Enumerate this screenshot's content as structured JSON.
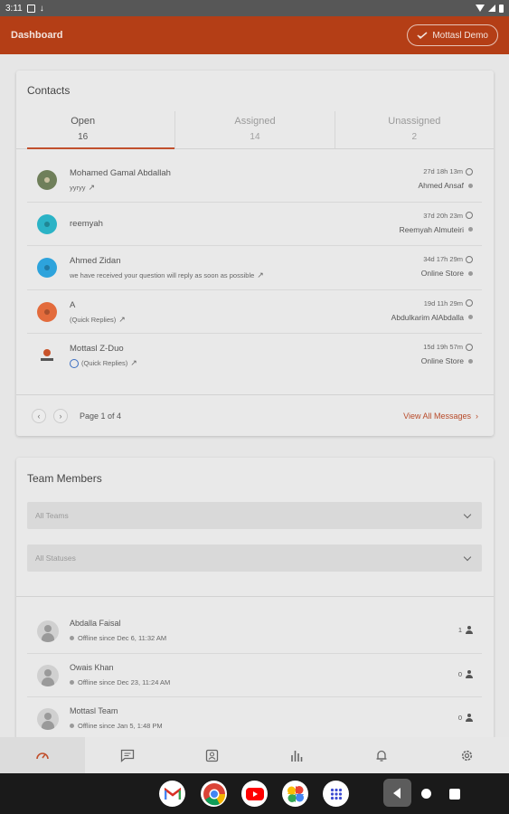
{
  "status_bar": {
    "time": "3:11"
  },
  "app_bar": {
    "title": "Dashboard",
    "user_button": "Mottasl Demo"
  },
  "contacts": {
    "title": "Contacts",
    "tabs": [
      {
        "label": "Open",
        "count": "16"
      },
      {
        "label": "Assigned",
        "count": "14"
      },
      {
        "label": "Unassigned",
        "count": "2"
      }
    ],
    "messages": [
      {
        "name": "Mohamed Gamal Abdallah",
        "preview": "yyryy",
        "time": "27d 18h 13m",
        "agent": "Ahmed Ansaf",
        "avatar_color": "#6f7f5a"
      },
      {
        "name": "reemyah",
        "preview": "",
        "time": "37d 20h 23m",
        "agent": "Reemyah Almuteiri",
        "avatar_color": "#2bb3c6"
      },
      {
        "name": "Ahmed Zidan",
        "preview": "we have received your question will reply as soon as possible",
        "time": "34d 17h 29m",
        "agent": "Online Store",
        "avatar_color": "#2da3dc"
      },
      {
        "name": "A",
        "preview": "(Quick Replies)",
        "time": "19d 11h 29m",
        "agent": "Abdulkarim AlAbdalla",
        "avatar_color": "#e36b3c"
      },
      {
        "name": "Mottasl Z-Duo",
        "preview": "(Quick Replies)",
        "time": "15d 19h 57m",
        "agent": "Online Store",
        "avatar_color": "#e9e9e9"
      }
    ],
    "pagination": {
      "info": "Page 1 of 4",
      "view_all": "View All Messages"
    }
  },
  "team": {
    "title": "Team Members",
    "filter_teams": "All Teams",
    "filter_statuses": "All Statuses",
    "members": [
      {
        "name": "Abdalla Faisal",
        "status": "Offline since Dec 6, 11:32 AM",
        "count": "1"
      },
      {
        "name": "Owais Khan",
        "status": "Offline since Dec 23, 11:24 AM",
        "count": "0"
      },
      {
        "name": "Mottasl Team",
        "status": "Offline since Jan 5, 1:48 PM",
        "count": "0"
      }
    ]
  },
  "bottom_nav": [
    "dashboard-icon",
    "messages-icon",
    "contacts-icon",
    "reports-icon",
    "notifications-icon",
    "settings-icon"
  ],
  "colors": {
    "accent": "#b43e16",
    "link": "#b84b2a"
  }
}
